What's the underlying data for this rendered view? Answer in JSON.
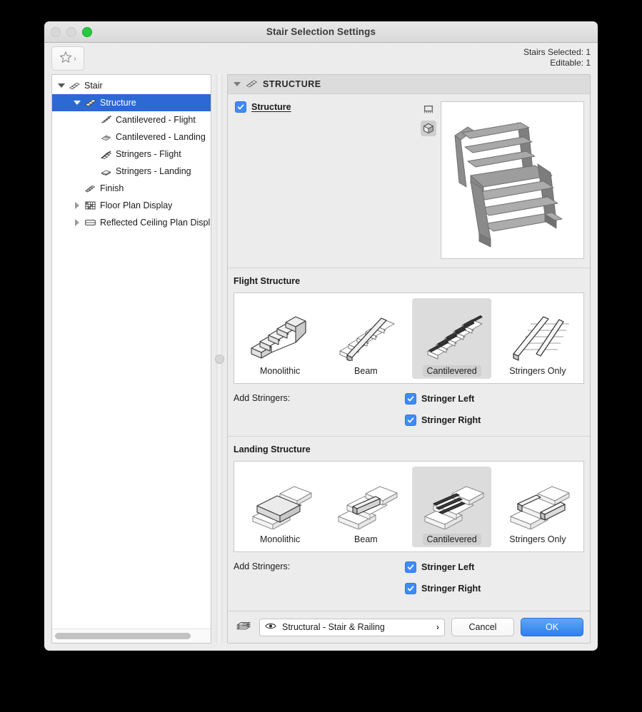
{
  "window": {
    "title": "Stair Selection Settings",
    "traffic_lights": [
      "close",
      "minimize",
      "zoom"
    ]
  },
  "toolbar": {
    "favorites_icon": "star-icon",
    "favorites_chevron": "›",
    "selection_info_line1": "Stairs Selected: 1",
    "selection_info_line2": "Editable: 1"
  },
  "tree": {
    "items": [
      {
        "label": "Stair",
        "depth": 0,
        "twisty": "down",
        "icon": "stair-icon",
        "selected": false
      },
      {
        "label": "Structure",
        "depth": 1,
        "twisty": "down",
        "icon": "structure-icon",
        "selected": true
      },
      {
        "label": "Cantilevered - Flight",
        "depth": 2,
        "twisty": "none",
        "icon": "cantilevered-flight-icon",
        "selected": false
      },
      {
        "label": "Cantilevered - Landing",
        "depth": 2,
        "twisty": "none",
        "icon": "cantilevered-landing-icon",
        "selected": false
      },
      {
        "label": "Stringers - Flight",
        "depth": 2,
        "twisty": "none",
        "icon": "stringers-flight-icon",
        "selected": false
      },
      {
        "label": "Stringers - Landing",
        "depth": 2,
        "twisty": "none",
        "icon": "stringers-landing-icon",
        "selected": false
      },
      {
        "label": "Finish",
        "depth": 1,
        "twisty": "none",
        "icon": "finish-icon",
        "selected": false
      },
      {
        "label": "Floor Plan Display",
        "depth": 1,
        "twisty": "right",
        "icon": "floor-plan-icon",
        "selected": false
      },
      {
        "label": "Reflected Ceiling Plan Displ",
        "depth": 1,
        "twisty": "right",
        "icon": "rcp-icon",
        "selected": false
      }
    ],
    "scrollbar": "horizontal"
  },
  "panel": {
    "section_title": "STRUCTURE",
    "section_icon": "structure-icon",
    "structure_checkbox": {
      "label": "Structure",
      "checked": true
    },
    "view_toggles": [
      {
        "name": "section-view-icon",
        "active": false
      },
      {
        "name": "3d-view-icon",
        "active": true
      }
    ],
    "preview": {
      "name": "stair-3d-preview"
    },
    "flight": {
      "title": "Flight Structure",
      "options": [
        {
          "label": "Monolithic",
          "icon": "monolithic-flight-icon",
          "selected": false
        },
        {
          "label": "Beam",
          "icon": "beam-flight-icon",
          "selected": false
        },
        {
          "label": "Cantilevered",
          "icon": "cantilevered-flight-icon",
          "selected": true
        },
        {
          "label": "Stringers Only",
          "icon": "stringers-only-flight-icon",
          "selected": false
        }
      ],
      "add_stringers_label": "Add Stringers:",
      "stringer_left": {
        "label": "Stringer Left",
        "checked": true
      },
      "stringer_right": {
        "label": "Stringer Right",
        "checked": true
      }
    },
    "landing": {
      "title": "Landing Structure",
      "options": [
        {
          "label": "Monolithic",
          "icon": "monolithic-landing-icon",
          "selected": false
        },
        {
          "label": "Beam",
          "icon": "beam-landing-icon",
          "selected": false
        },
        {
          "label": "Cantilevered",
          "icon": "cantilevered-landing-icon",
          "selected": true
        },
        {
          "label": "Stringers Only",
          "icon": "stringers-only-landing-icon",
          "selected": false
        }
      ],
      "add_stringers_label": "Add Stringers:",
      "stringer_left": {
        "label": "Stringer Left",
        "checked": true
      },
      "stringer_right": {
        "label": "Stringer Right",
        "checked": true
      }
    }
  },
  "footer": {
    "layer_icon": "layers-icon",
    "layer_combo": {
      "eye_icon": "eye-icon",
      "value": "Structural - Stair & Railing",
      "chevron": "›"
    },
    "cancel_label": "Cancel",
    "ok_label": "OK"
  },
  "colors": {
    "selection_blue": "#2c69d4",
    "checkbox_blue": "#3d8bfd",
    "ok_button_blue": "#2f7fec",
    "window_bg": "#ececec",
    "section_header_bg": "#dcdcdc",
    "tile_selected_bg": "#dcdcdc",
    "zoom_light_green": "#28c940"
  }
}
